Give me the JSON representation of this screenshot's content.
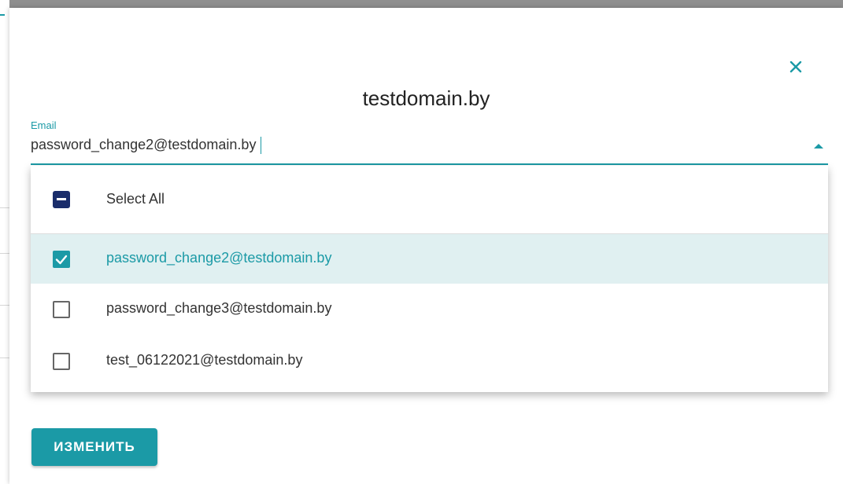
{
  "dialog": {
    "title": "testdomain.by",
    "close_icon": "close-icon"
  },
  "email_field": {
    "label": "Email",
    "value": "password_change2@testdomain.by",
    "expanded": true
  },
  "dropdown": {
    "options": [
      {
        "label": "Select All",
        "state": "indeterminate"
      },
      {
        "label": "password_change2@testdomain.by",
        "state": "checked"
      },
      {
        "label": "password_change3@testdomain.by",
        "state": "unchecked"
      },
      {
        "label": "test_06122021@testdomain.by",
        "state": "unchecked"
      }
    ]
  },
  "actions": {
    "submit_label": "ИЗМЕНИТЬ"
  },
  "colors": {
    "accent": "#1b9aa6",
    "select_all_box": "#1a2d6b",
    "selected_row_bg": "#e0f0f1"
  }
}
